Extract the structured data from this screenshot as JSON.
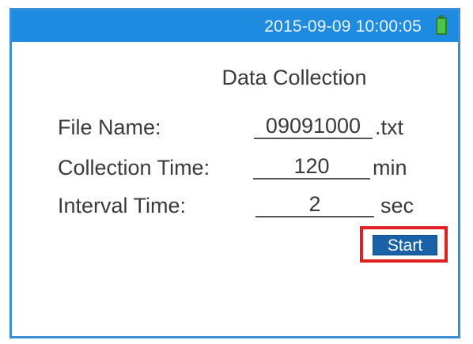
{
  "status_bar": {
    "datetime": "2015-09-09 10:00:05",
    "battery_icon": "battery-full-icon",
    "battery_color": "#4cc44c",
    "bar_color": "#1e8be0"
  },
  "page": {
    "title": "Data Collection"
  },
  "form": {
    "file_name": {
      "label": "File Name:",
      "value": "09091000",
      "suffix": ".txt"
    },
    "collection_time": {
      "label": "Collection Time:",
      "value": "120",
      "suffix": "min"
    },
    "interval_time": {
      "label": "Interval Time:",
      "value": "2",
      "suffix": "sec"
    }
  },
  "actions": {
    "start_label": "Start",
    "highlight_color": "#e02020"
  }
}
